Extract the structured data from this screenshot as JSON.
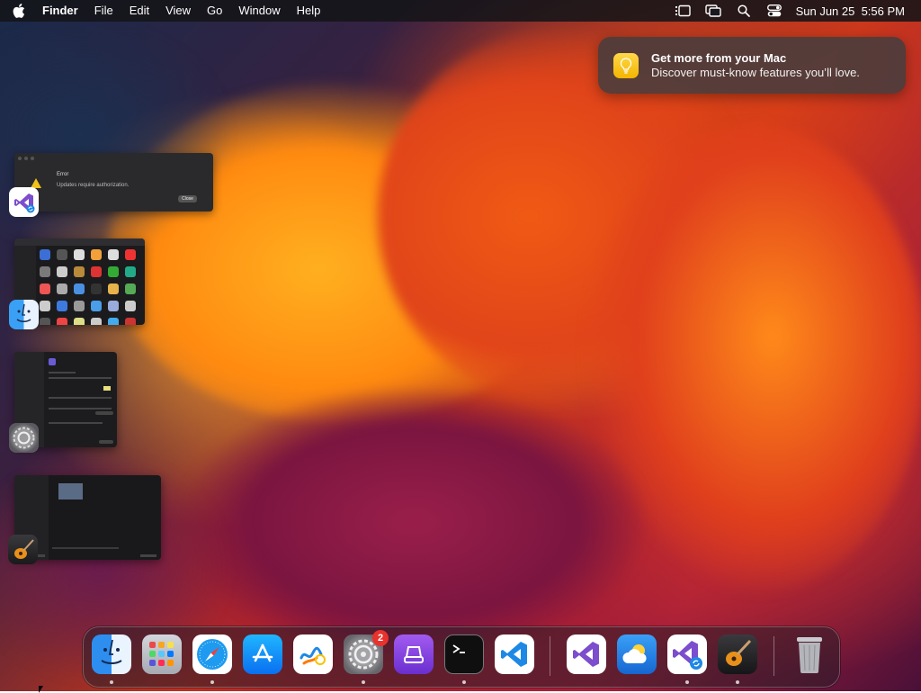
{
  "menubar": {
    "app_name": "Finder",
    "menus": [
      "File",
      "Edit",
      "View",
      "Go",
      "Window",
      "Help"
    ],
    "status_icons": [
      "reading-list-icon",
      "screen-mirroring-icon",
      "spotlight-search-icon",
      "control-center-icon"
    ],
    "datetime": "Sun Jun 25  5:56 PM"
  },
  "notification": {
    "title": "Get more from your Mac",
    "body": "Discover must-know features you’ll love.",
    "icon": "lightbulb-icon"
  },
  "stage_manager": {
    "error_dialog": {
      "title": "Error",
      "message": "Updates require authorization.",
      "close_label": "Close",
      "app_icon": "visual-studio-installer-icon"
    },
    "finder_window": {
      "app_icon": "finder-icon"
    },
    "settings_window": {
      "app_icon": "system-settings-icon"
    },
    "garageband_window": {
      "app_icon": "garageband-icon"
    }
  },
  "dock": {
    "settings_badge": "2",
    "items": [
      {
        "name": "finder",
        "running": true
      },
      {
        "name": "launchpad",
        "running": false
      },
      {
        "name": "safari",
        "running": true
      },
      {
        "name": "app-store",
        "running": false
      },
      {
        "name": "freeform",
        "running": false
      },
      {
        "name": "system-settings",
        "running": true
      },
      {
        "name": "apple-configurator",
        "running": false
      },
      {
        "name": "terminal",
        "running": true
      },
      {
        "name": "visual-studio-code",
        "running": false
      },
      {
        "name": "visual-studio",
        "running": false
      },
      {
        "name": "weather",
        "running": false
      },
      {
        "name": "visual-studio-installer",
        "running": true
      },
      {
        "name": "garageband",
        "running": true
      },
      {
        "name": "trash",
        "running": false
      }
    ]
  },
  "colors": {
    "menubar_bg": "#141418",
    "notification_bg": "#463c3e",
    "badge_red": "#e8322d",
    "vs_purple": "#7c4dcc",
    "vscode_blue": "#1e88e5"
  }
}
